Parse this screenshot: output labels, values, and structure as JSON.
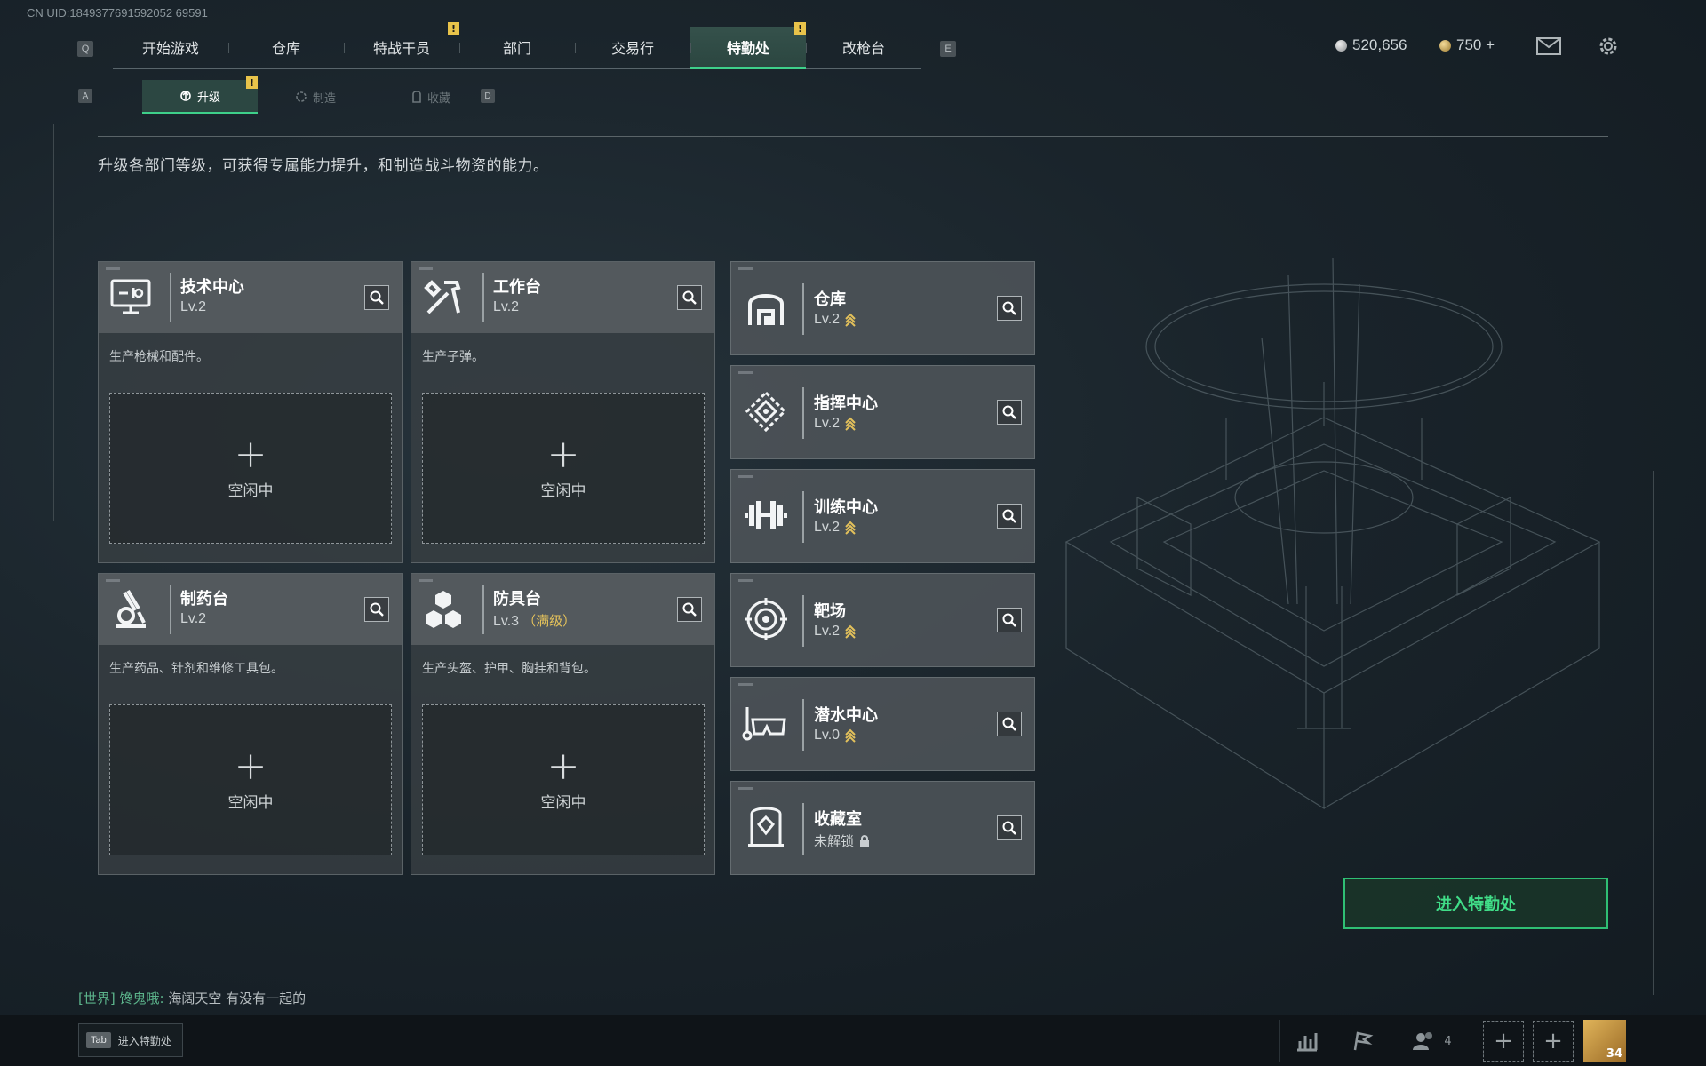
{
  "uid": "CN UID:1849377691592052 69591",
  "nav": {
    "key_left": "Q",
    "key_right": "E",
    "tabs": [
      {
        "label": "开始游戏"
      },
      {
        "label": "仓库"
      },
      {
        "label": "特战干员",
        "alert": "!"
      },
      {
        "label": "部门"
      },
      {
        "label": "交易行"
      },
      {
        "label": "特勤处",
        "alert": "!",
        "active": true
      },
      {
        "label": "改枪台"
      }
    ]
  },
  "currency": {
    "silver": "520,656",
    "gold": "750 +"
  },
  "subnav": {
    "key_left": "A",
    "key_right": "D",
    "tabs": [
      {
        "label": "升级",
        "alert": "!",
        "active": true
      },
      {
        "label": "制造"
      },
      {
        "label": "收藏"
      }
    ]
  },
  "description": "升级各部门等级，可获得专属能力提升，和制造战斗物资的能力。",
  "production": [
    {
      "title": "技术中心",
      "level": "Lv.2",
      "max": "",
      "desc": "生产枪械和配件。",
      "slot_plus": "+",
      "slot_status": "空闲中",
      "icon": "computer-icon"
    },
    {
      "title": "工作台",
      "level": "Lv.2",
      "max": "",
      "desc": "生产子弹。",
      "slot_plus": "+",
      "slot_status": "空闲中",
      "icon": "tools-icon"
    },
    {
      "title": "制药台",
      "level": "Lv.2",
      "max": "",
      "desc": "生产药品、针剂和维修工具包。",
      "slot_plus": "+",
      "slot_status": "空闲中",
      "icon": "microscope-icon"
    },
    {
      "title": "防具台",
      "level": "Lv.3",
      "max": "（满级）",
      "desc": "生产头盔、护甲、胸挂和背包。",
      "slot_plus": "+",
      "slot_status": "空闲中",
      "icon": "cubes-icon"
    }
  ],
  "facilities": [
    {
      "title": "仓库",
      "level": "Lv.2",
      "locked": false,
      "icon": "warehouse-icon"
    },
    {
      "title": "指挥中心",
      "level": "Lv.2",
      "locked": false,
      "icon": "command-icon"
    },
    {
      "title": "训练中心",
      "level": "Lv.2",
      "locked": false,
      "icon": "dumbbell-icon"
    },
    {
      "title": "靶场",
      "level": "Lv.2",
      "locked": false,
      "icon": "target-icon"
    },
    {
      "title": "潜水中心",
      "level": "Lv.0",
      "locked": false,
      "icon": "diving-mask-icon"
    },
    {
      "title": "收藏室",
      "level": "未解锁",
      "locked": true,
      "icon": "collection-icon"
    }
  ],
  "enter_button": "进入特勤处",
  "chat": {
    "channel": "[世界]",
    "name": "馋鬼哦:",
    "message": "海阔天空 有没有一起的"
  },
  "bottom": {
    "tab_key": "Tab",
    "tab_label": "进入特勤处",
    "friends_count": "4",
    "avatar_level": "34"
  },
  "colors": {
    "accent_green": "#3ed08a",
    "alert_yellow": "#e8c34a",
    "max_gold": "#e3c15b"
  }
}
